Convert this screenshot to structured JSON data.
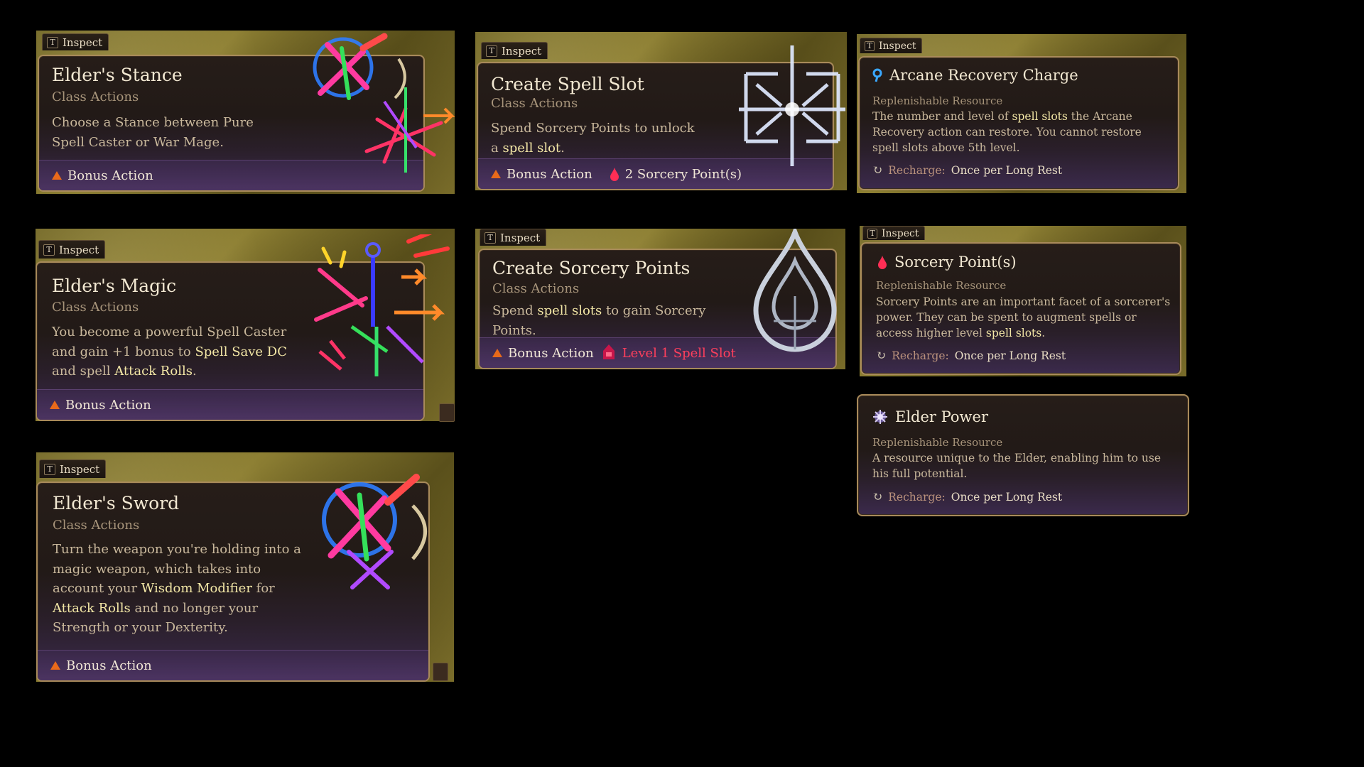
{
  "ui": {
    "inspect_key": "T",
    "inspect_label": "Inspect"
  },
  "colors": {
    "frame_gold": "#8d7f33",
    "card_bg": "#221a17",
    "card_border": "#a88a5a",
    "footer_purple": "#4c3462",
    "action_triangle": "#e86a1a",
    "sorcery_red": "#ff3f5c",
    "keyword_highlight": "#f3e7a6"
  },
  "cards": {
    "elders_stance": {
      "title": "Elder's Stance",
      "subtitle": "Class Actions",
      "description": "Choose a Stance between Pure Spell Caster or War Mage.",
      "action": "Bonus Action",
      "art_icon": "arcane-star-icon"
    },
    "create_spell_slot": {
      "title": "Create Spell Slot",
      "subtitle": "Class Actions",
      "desc_pre": "Spend Sorcery Points to unlock a ",
      "desc_hl": "spell slot",
      "desc_post": ".",
      "action": "Bonus Action",
      "cost": "2 Sorcery Point(s)",
      "art_icon": "spell-slot-rune-icon"
    },
    "elders_magic": {
      "title": "Elder's Magic",
      "subtitle": "Class Actions",
      "desc_pre": "You become a powerful Spell Caster and gain +1 bonus to ",
      "desc_hl1": "Spell Save DC",
      "desc_mid": " and spell ",
      "desc_hl2": "Attack Rolls",
      "desc_post": ".",
      "action": "Bonus Action",
      "art_icon": "arcane-burst-icon"
    },
    "create_sorcery_points": {
      "title": "Create Sorcery Points",
      "subtitle": "Class Actions",
      "desc_pre": "Spend ",
      "desc_hl": "spell slots",
      "desc_post": " to gain Sorcery Points.",
      "action": "Bonus Action",
      "cost": "Level 1 Spell Slot",
      "art_icon": "sorcery-flame-drop-icon"
    },
    "elders_sword": {
      "title": "Elder's Sword",
      "subtitle": "Class Actions",
      "desc_pre": "Turn the weapon you're holding into a magic weapon, which takes into account your ",
      "desc_hl1": "Wisdom Modifier",
      "desc_mid": " for ",
      "desc_hl2": "Attack Rolls",
      "desc_post": " and no longer your Strength or your Dexterity.",
      "action": "Bonus Action",
      "art_icon": "arcane-star-icon"
    }
  },
  "resources": {
    "arcane_recovery": {
      "title": "Arcane Recovery Charge",
      "subtitle": "Replenishable Resource",
      "desc_pre": "The number and level of ",
      "desc_hl": "spell slots",
      "desc_post": " the Arcane Recovery action can restore. You cannot restore spell slots above 5th level.",
      "recharge_label": "Recharge:",
      "recharge_value": "Once per Long Rest",
      "icon": "arcane-charge-icon"
    },
    "sorcery_points": {
      "title": "Sorcery Point(s)",
      "subtitle": "Replenishable Resource",
      "desc_pre": "Sorcery Points are an important facet of a sorcerer's power. They can be spent to augment spells or access higher level ",
      "desc_hl": "spell slots",
      "desc_post": ".",
      "recharge_label": "Recharge:",
      "recharge_value": "Once per Long Rest",
      "icon": "sorcery-point-icon"
    },
    "elder_power": {
      "title": "Elder Power",
      "subtitle": "Replenishable Resource",
      "description": "A resource unique to the Elder, enabling him to use his full potential.",
      "recharge_label": "Recharge:",
      "recharge_value": "Once per Long Rest",
      "icon": "elder-power-icon"
    }
  }
}
